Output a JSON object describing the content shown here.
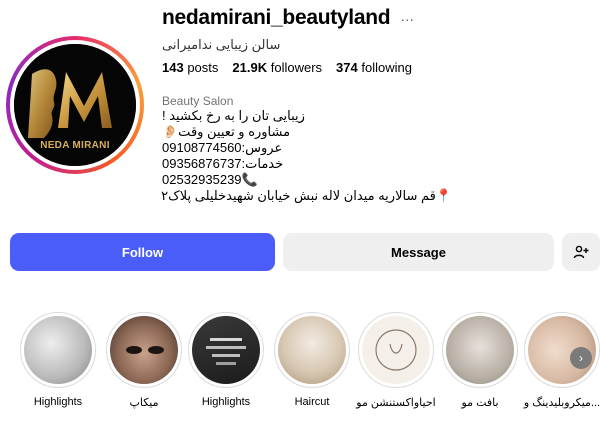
{
  "profile": {
    "username": "nedamirani_beautyland",
    "more_icon": "…",
    "full_name": "سالن زیبایی ندامیرانی",
    "avatar_brand": "NEDA MIRANI",
    "avatar_letter": "M"
  },
  "stats": {
    "posts_count": "143",
    "posts_label": "posts",
    "followers_count": "21.9K",
    "followers_label": "followers",
    "following_count": "374",
    "following_label": "following"
  },
  "bio": {
    "category": "Beauty Salon",
    "lines": [
      "زیبایی تان را به رخ بکشید !",
      "مشاوره و تعیین وقت👂🏻",
      "عروس:09108774560",
      "خدمات:09356876737",
      "02532935239📞",
      "📍قم سالاریه میدان لاله نبش خیابان شهیدخلیلی پلاک۲"
    ]
  },
  "actions": {
    "follow": "Follow",
    "message": "Message",
    "suggest_icon": "add-person-icon"
  },
  "highlights": [
    {
      "label": "Highlights"
    },
    {
      "label": "میکاپ"
    },
    {
      "label": "Highlights"
    },
    {
      "label": "Haircut"
    },
    {
      "label": "احیاواکستنشن مو"
    },
    {
      "label": "بافت مو"
    },
    {
      "label": "میکروبلیدینگ و..."
    }
  ],
  "colors": {
    "follow_bg": "#4a5df9",
    "ring_gradient": [
      "#e6296c",
      "#f9a13a",
      "#c51d8d",
      "#8a2bc4"
    ],
    "brand_gold": "#d8b05a"
  }
}
